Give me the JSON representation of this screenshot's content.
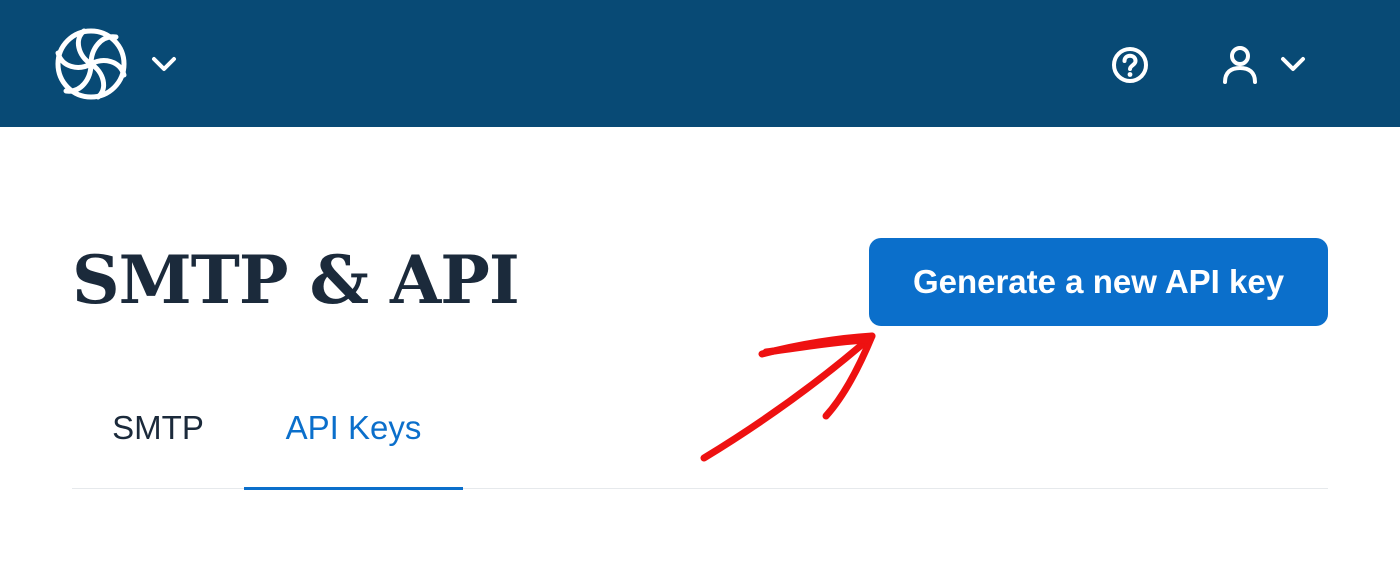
{
  "header": {
    "logo_icon": "brand-swirl-logo-icon",
    "menu_chevron_icon": "chevron-down-icon",
    "help_icon": "help-circle-icon",
    "user_icon": "user-icon",
    "background_color": "#084a75"
  },
  "page": {
    "title": "SMTP & API",
    "primary_action_label": "Generate a new API key"
  },
  "tabs": [
    {
      "label": "SMTP",
      "active": false
    },
    {
      "label": "API Keys",
      "active": true
    }
  ],
  "annotation": {
    "arrow_color": "#ee1111"
  },
  "colors": {
    "accent": "#0b6fcb",
    "title_text": "#1b2a3b"
  }
}
